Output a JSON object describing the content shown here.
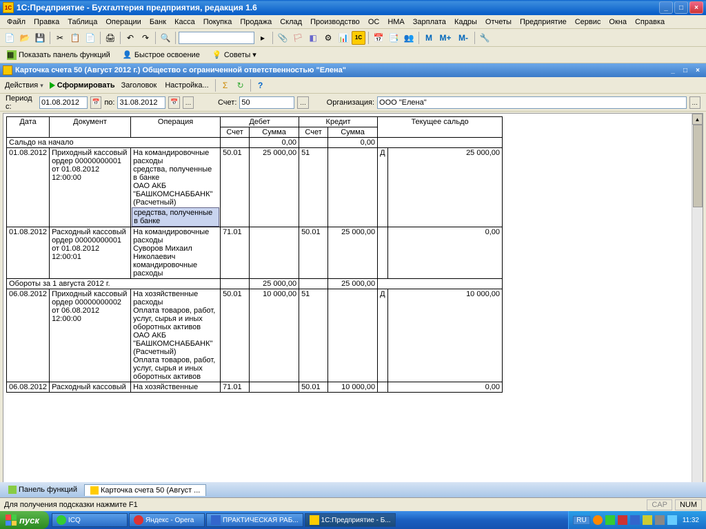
{
  "window": {
    "title": "1С:Предприятие - Бухгалтерия предприятия, редакция 1.6"
  },
  "menu": [
    "Файл",
    "Правка",
    "Таблица",
    "Операции",
    "Банк",
    "Касса",
    "Покупка",
    "Продажа",
    "Склад",
    "Производство",
    "ОС",
    "НМА",
    "Зарплата",
    "Кадры",
    "Отчеты",
    "Предприятие",
    "Сервис",
    "Окна",
    "Справка"
  ],
  "functoolbar": {
    "show_panel": "Показать панель функций",
    "fast": "Быстрое освоение",
    "advice": "Советы"
  },
  "doc": {
    "title": "Карточка счета 50 (Август 2012 г.) Общество с ограниченной ответственностью \"Елена\""
  },
  "actions": {
    "label": "Действия",
    "form": "Сформировать",
    "header": "Заголовок",
    "settings": "Настройка..."
  },
  "period": {
    "from_label": "Период с:",
    "from": "01.08.2012",
    "to_label": "по:",
    "to": "31.08.2012",
    "account_label": "Счет:",
    "account": "50",
    "org_label": "Организация:",
    "org": "ООО \"Елена\""
  },
  "grid": {
    "headers": {
      "date": "Дата",
      "doc": "Документ",
      "op": "Операция",
      "debit": "Дебет",
      "credit": "Кредит",
      "balance": "Текущее сальдо",
      "acct": "Счет",
      "sum": "Сумма"
    },
    "opening": {
      "label": "Сальдо на начало",
      "d": "0,00",
      "c": "0,00"
    },
    "rows": [
      {
        "date": "01.08.2012",
        "doc": "Приходный кассовый ордер 00000000001 от 01.08.2012 12:00:00",
        "op": "На командировочные расходы\nсредства, полученные в банке\nОАО АКБ \"БАШКОМСНАББАНК\" (Расчетный)",
        "op_hl": "средства, полученные в банке",
        "d_acct": "50.01",
        "d_sum": "25 000,00",
        "c_acct": "51",
        "c_sum": "",
        "bal_dc": "Д",
        "bal": "25 000,00"
      },
      {
        "date": "01.08.2012",
        "doc": "Расходный кассовый ордер 00000000001 от 01.08.2012 12:00:01",
        "op": "На командировочные расходы\nСуворов Михаил Николаевич командировочные расходы",
        "d_acct": "71.01",
        "d_sum": "",
        "c_acct": "50.01",
        "c_sum": "25 000,00",
        "bal_dc": "",
        "bal": "0,00"
      }
    ],
    "turnover": {
      "label": "Обороты за 1 августа 2012 г.",
      "d": "25 000,00",
      "c": "25 000,00"
    },
    "rows2": [
      {
        "date": "06.08.2012",
        "doc": "Приходный кассовый ордер 00000000002 от 06.08.2012 12:00:00",
        "op": "На хозяйственные расходы\nОплата товаров, работ, услуг, сырья и иных оборотных активов\nОАО АКБ \"БАШКОМСНАББАНК\" (Расчетный)\nОплата товаров, работ, услуг, сырья и иных оборотных активов",
        "d_acct": "50.01",
        "d_sum": "10 000,00",
        "c_acct": "51",
        "c_sum": "",
        "bal_dc": "Д",
        "bal": "10 000,00"
      },
      {
        "date": "06.08.2012",
        "doc": "Расходный кассовый",
        "op": "На хозяйственные",
        "d_acct": "71.01",
        "d_sum": "",
        "c_acct": "50.01",
        "c_sum": "10 000,00",
        "bal_dc": "",
        "bal": "0,00"
      }
    ]
  },
  "tabs": {
    "panel": "Панель функций",
    "card": "Карточка счета 50 (Август ..."
  },
  "status": {
    "hint": "Для получения подсказки нажмите F1",
    "cap": "CAP",
    "num": "NUM"
  },
  "taskbar": {
    "start": "пуск",
    "tasks": [
      "ICQ",
      "Яндекс - Opera",
      "ПРАКТИЧЕСКАЯ РАБ...",
      "1С:Предприятие - Б..."
    ],
    "lang": "RU",
    "time": "11:32"
  },
  "toolbar_m": {
    "m": "M",
    "mp": "M+",
    "mm": "M-"
  }
}
